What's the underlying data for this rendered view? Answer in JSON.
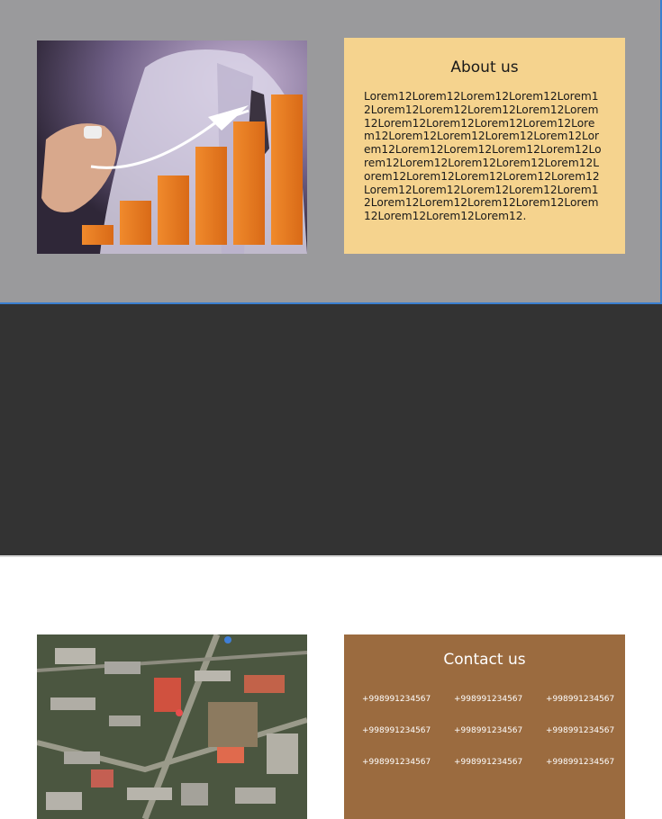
{
  "about": {
    "title": "About us",
    "text": "Lorem12Lorem12Lorem12Lorem12Lorem12Lorem12Lorem12Lorem12Lorem12Lorem12Lorem12Lorem12Lorem12Lorem12Lorem12Lorem12Lorem12Lorem12Lorem12Lorem12Lorem12Lorem12Lorem12Lorem12Lorem12Lorem12Lorem12Lorem12Lorem12Lorem12Lorem12Lorem12Lorem12Lorem12Lorem12Lorem12Lorem12Lorem12Lorem12Lorem12Lorem12Lorem12Lorem12Lorem12Lorem12Lorem12Lorem12."
  },
  "contact": {
    "title": "Contact us",
    "phones": [
      "+998991234567",
      "+998991234567",
      "+998991234567",
      "+998991234567",
      "+998991234567",
      "+998991234567",
      "+998991234567",
      "+998991234567",
      "+998991234567"
    ]
  },
  "colors": {
    "top_bg": "#9a9a9c",
    "bottom_bg": "#333333",
    "about_bg": "#f5d38e",
    "contact_bg": "#9b6b3f",
    "accent_border": "#3a7fcf"
  }
}
